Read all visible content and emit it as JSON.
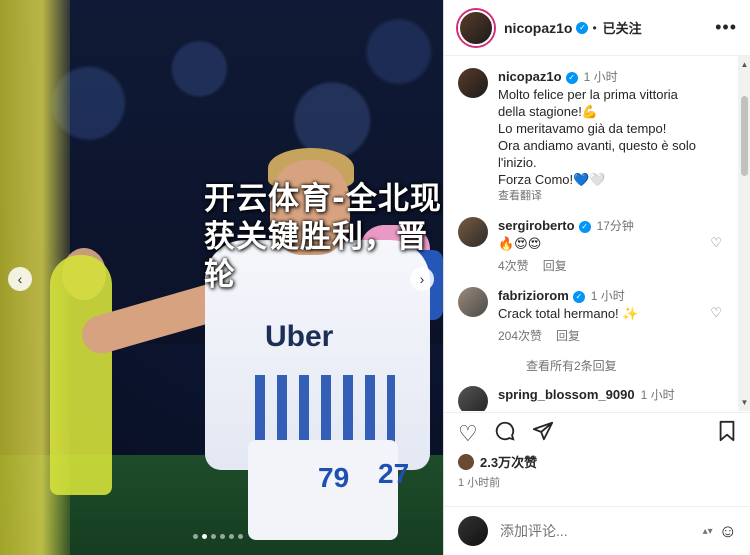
{
  "overlay": {
    "headline": "开云体育-全北现代在关键比赛中收获关键胜利，晋级下一轮",
    "line1": "开云体育-全北现",
    "line2": "获关键胜利，晋",
    "line3": "轮"
  },
  "photo": {
    "sponsor": "Uber",
    "number_front": "79",
    "number_back": "27"
  },
  "header": {
    "username": "nicopaz1o",
    "follow_label": "已关注",
    "more": "•••"
  },
  "caption": {
    "username": "nicopaz1o",
    "time": "1 小时",
    "lines": [
      "Molto felice per la prima vittoria",
      "della stagione!💪",
      "Lo meritavamo già da tempo!",
      "Ora andiamo avanti, questo è solo",
      "l'inizio.",
      "Forza Como!💙🤍"
    ],
    "translate": "查看翻译"
  },
  "comments": [
    {
      "username": "sergiroberto",
      "time": "17分钟",
      "text": "🔥😍😍",
      "likes": "4次赞",
      "reply": "回复"
    },
    {
      "username": "fabriziorom",
      "time": "1 小时",
      "text": "Crack total hermano! ✨",
      "likes": "204次赞",
      "reply": "回复"
    },
    {
      "username": "spring_blossom_9090",
      "time": "1 小时"
    }
  ],
  "view_replies": "查看所有2条回复",
  "likes": "2.3万次赞",
  "post_time": "1 小时前",
  "add_comment": {
    "placeholder": "添加评论..."
  }
}
